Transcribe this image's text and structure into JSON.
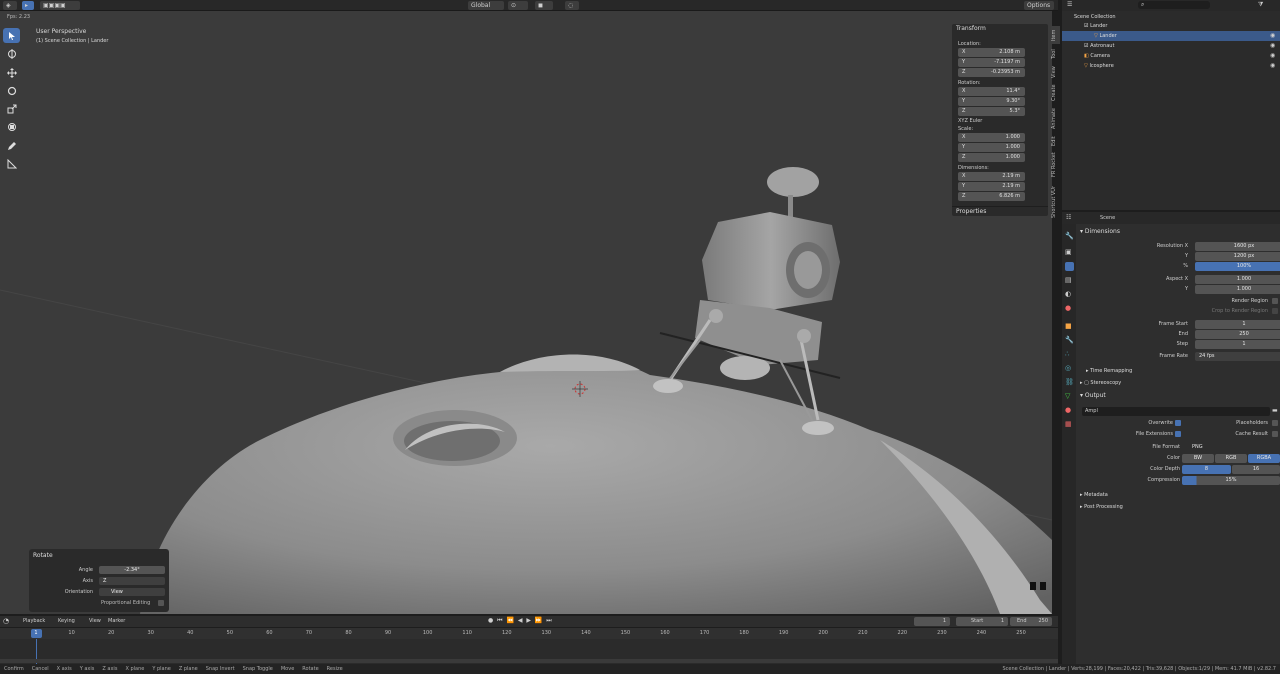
{
  "header": {
    "fps_label": "Fps: 2.23",
    "orientation": "Global",
    "options": "Options"
  },
  "viewport": {
    "perspective": "User Perspective",
    "collection_label": "(1) Scene Collection | Lander"
  },
  "transform_panel": {
    "title": "Transform",
    "location_label": "Location:",
    "location": [
      {
        "axis": "X",
        "value": "2.108 m"
      },
      {
        "axis": "Y",
        "value": "-7.1197 m"
      },
      {
        "axis": "Z",
        "value": "-0.23953 m"
      }
    ],
    "rotation_label": "Rotation:",
    "rotation": [
      {
        "axis": "X",
        "value": "11.4°"
      },
      {
        "axis": "Y",
        "value": "9.30°"
      },
      {
        "axis": "Z",
        "value": "5.3°"
      }
    ],
    "rotation_mode": "XYZ Euler",
    "scale_label": "Scale:",
    "scale": [
      {
        "axis": "X",
        "value": "1.000"
      },
      {
        "axis": "Y",
        "value": "1.000"
      },
      {
        "axis": "Z",
        "value": "1.000"
      }
    ],
    "dimensions_label": "Dimensions:",
    "dimensions": [
      {
        "axis": "X",
        "value": "2.19 m"
      },
      {
        "axis": "Y",
        "value": "2.19 m"
      },
      {
        "axis": "Z",
        "value": "6.826 m"
      }
    ],
    "properties_title": "Properties"
  },
  "side_tabs": [
    "Item",
    "Tool",
    "View",
    "Create",
    "Animate",
    "Edit",
    "FR Rocket",
    "Shortcut VUr"
  ],
  "redo_panel": {
    "title": "Rotate",
    "angle_label": "Angle",
    "angle_value": "-2.34°",
    "axis_label": "Axis",
    "axis_value": "Z",
    "orientation_label": "Orientation",
    "orientation_value": "View",
    "proportional_label": "Proportional Editing"
  },
  "timeline": {
    "menus": [
      "Playback",
      "Keying",
      "View",
      "Marker"
    ],
    "current_frame": "1",
    "start_label": "Start",
    "start_value": "1",
    "end_label": "End",
    "end_value": "250",
    "ticks": [
      "1",
      "10",
      "20",
      "30",
      "40",
      "50",
      "60",
      "70",
      "80",
      "90",
      "100",
      "110",
      "120",
      "130",
      "140",
      "150",
      "160",
      "170",
      "180",
      "190",
      "200",
      "210",
      "220",
      "230",
      "240",
      "250"
    ]
  },
  "status_bar": {
    "items": [
      "Confirm",
      "Cancel",
      "X axis",
      "Y axis",
      "Z axis",
      "X plane",
      "Y plane",
      "Z plane",
      "Snap Invert",
      "Snap Toggle",
      "Move",
      "Rotate",
      "Resize"
    ],
    "stats": "Scene Collection | Lander | Verts:28,199 | Faces:20,422 | Tris:39,628 | Objects:1/29 | Mem: 41.7 MiB | v2.82.7"
  },
  "outliner": {
    "root": "Scene Collection",
    "rows": [
      "Lander",
      "Lander",
      "Astronaut",
      "Camera",
      "Icosphere"
    ]
  },
  "properties": {
    "scene_label": "Scene",
    "dimensions_section": "Dimensions",
    "resolution_x_label": "Resolution X",
    "resolution_x": "1600 px",
    "resolution_y_label": "Y",
    "resolution_y": "1200 px",
    "percent_label": "%",
    "percent": "100%",
    "aspect_x_label": "Aspect X",
    "aspect_x": "1.000",
    "aspect_y_label": "Y",
    "aspect_y": "1.000",
    "render_region": "Render Region",
    "crop_region": "Crop to Render Region",
    "frame_start_label": "Frame Start",
    "frame_start": "1",
    "frame_end_label": "End",
    "frame_end": "250",
    "step_label": "Step",
    "step": "1",
    "frame_rate_label": "Frame Rate",
    "frame_rate": "24 fps",
    "time_remapping": "Time Remapping",
    "stereoscopy": "Stereoscopy",
    "output_section": "Output",
    "output_path": "Ampl",
    "overwrite": "Overwrite",
    "placeholders": "Placeholders",
    "file_extensions": "File Extensions",
    "cache_result": "Cache Result",
    "file_format_label": "File Format",
    "file_format": "PNG",
    "color_label": "Color",
    "color_options": [
      "BW",
      "RGB",
      "RGBA"
    ],
    "color_depth_label": "Color Depth",
    "color_depth_options": [
      "8",
      "16"
    ],
    "compression_label": "Compression",
    "compression": "15%",
    "metadata": "Metadata",
    "post_processing": "Post Processing"
  },
  "colors": {
    "accent": "#4772b3",
    "viewport_bg": "#3b3b3b",
    "panel_bg": "#2a2a2a"
  }
}
